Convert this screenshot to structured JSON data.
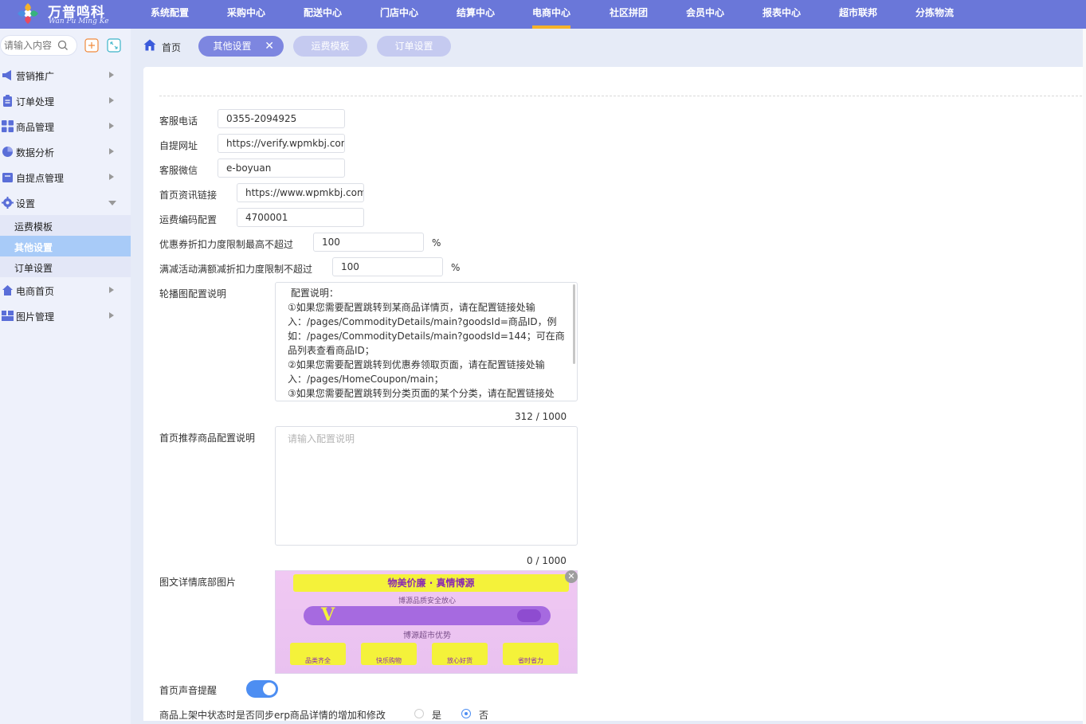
{
  "brand": {
    "name_cn": "万普鸣科",
    "name_en": "Wan Pu Ming Ke"
  },
  "top_nav": [
    {
      "label": "系统配置"
    },
    {
      "label": "采购中心"
    },
    {
      "label": "配送中心"
    },
    {
      "label": "门店中心"
    },
    {
      "label": "结算中心"
    },
    {
      "label": "电商中心"
    },
    {
      "label": "社区拼团"
    },
    {
      "label": "会员中心"
    },
    {
      "label": "报表中心"
    },
    {
      "label": "超市联邦"
    },
    {
      "label": "分拣物流"
    }
  ],
  "active_nav": "电商中心",
  "sidebar": {
    "search_placeholder": "请输入内容",
    "items": [
      {
        "label": "营销推广",
        "icon": "megaphone-icon"
      },
      {
        "label": "订单处理",
        "icon": "clipboard-icon"
      },
      {
        "label": "商品管理",
        "icon": "grid-icon"
      },
      {
        "label": "数据分析",
        "icon": "pie-chart-icon"
      },
      {
        "label": "自提点管理",
        "icon": "store-icon"
      },
      {
        "label": "设置",
        "icon": "gear-icon"
      },
      {
        "label": "电商首页",
        "icon": "home-icon"
      },
      {
        "label": "图片管理",
        "icon": "image-grid-icon"
      }
    ],
    "sub_items": [
      {
        "label": "运费模板"
      },
      {
        "label": "其他设置"
      },
      {
        "label": "订单设置"
      }
    ]
  },
  "tabs": {
    "home": "首页",
    "items": [
      {
        "label": "其他设置",
        "active": true
      },
      {
        "label": "运费模板",
        "active": false
      },
      {
        "label": "订单设置",
        "active": false
      }
    ],
    "close_glyph": "✕"
  },
  "form": {
    "service_phone": {
      "label": "客服电话",
      "value": "0355-2094925"
    },
    "pickup_url": {
      "label": "自提网址",
      "value": "https://verify.wpmkbj.com"
    },
    "service_wechat": {
      "label": "客服微信",
      "value": "e-boyuan"
    },
    "news_link": {
      "label": "首页资讯链接",
      "value": "https://www.wpmkbj.com"
    },
    "freight_code": {
      "label": "运费编码配置",
      "value": "4700001"
    },
    "coupon_limit": {
      "label": "优惠券折扣力度限制最高不超过",
      "value": "100",
      "unit": "%"
    },
    "discount_limit": {
      "label": "满减活动满额减折扣力度限制不超过",
      "value": "100",
      "unit": "%"
    },
    "carousel_desc": {
      "label": "轮播图配置说明",
      "lines": [
        " 配置说明：",
        "①如果您需要配置跳转到某商品详情页，请在配置链接处输",
        "入：/pages/CommodityDetails/main?goodsId=商品ID，例",
        "如：/pages/CommodityDetails/main?goodsId=144；可在商",
        "品列表查看商品ID；",
        "②如果您需要配置跳转到优惠券领取页面，请在配置链接处输",
        "入：/pages/HomeCoupon/main；",
        "③如果您需要配置跳转到分类页面的某个分类，请在配置链接处"
      ],
      "counter": "312 / 1000"
    },
    "recommend_desc": {
      "label": "首页推荐商品配置说明",
      "placeholder": "请输入配置说明",
      "counter": "0 / 1000"
    },
    "bottom_image": {
      "label": "图文详情底部图片",
      "banner_title": "物美价廉 · 真情博源",
      "banner_sub": "博源品质安全放心",
      "banner_section": "博源超市优势",
      "features": [
        "品类齐全",
        "快乐购物",
        "放心好货",
        "省时省力"
      ]
    },
    "sound_alert": {
      "label": "首页声音提醒",
      "on": true
    },
    "erp_sync": {
      "label": "商品上架中状态时是否同步erp商品详情的增加和修改",
      "options": [
        "是",
        "否"
      ],
      "selected": "否"
    }
  }
}
